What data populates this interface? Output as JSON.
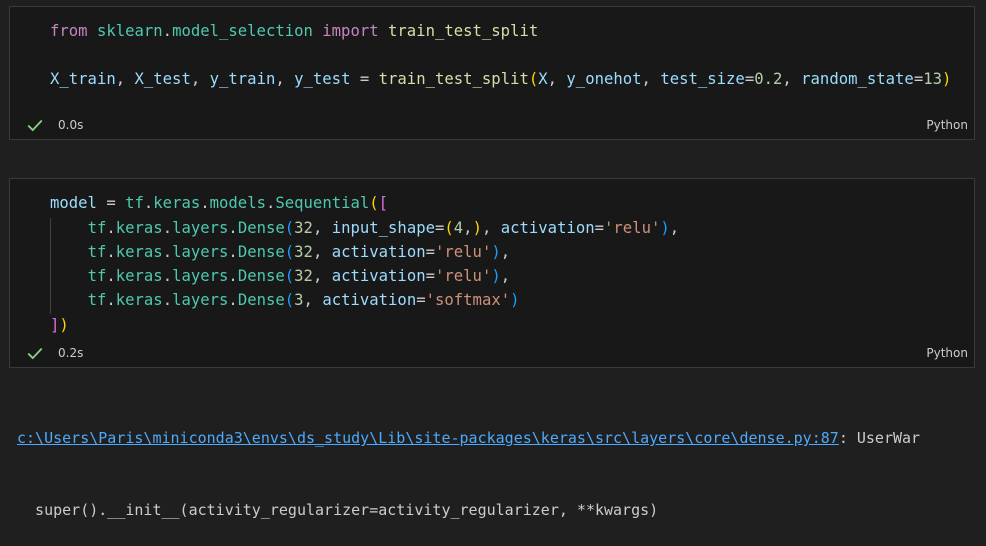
{
  "cells": [
    {
      "exec_time": "0.0s",
      "language": "Python",
      "lines": [
        [
          [
            "kw-ctrl",
            "from"
          ],
          [
            "plain",
            " "
          ],
          [
            "mod",
            "sklearn"
          ],
          [
            "plain",
            "."
          ],
          [
            "mod",
            "model_selection"
          ],
          [
            "plain",
            " "
          ],
          [
            "kw-ctrl",
            "import"
          ],
          [
            "plain",
            " "
          ],
          [
            "fn",
            "train_test_split"
          ]
        ],
        [],
        [
          [
            "var",
            "X_train"
          ],
          [
            "plain",
            ", "
          ],
          [
            "var",
            "X_test"
          ],
          [
            "plain",
            ", "
          ],
          [
            "var",
            "y_train"
          ],
          [
            "plain",
            ", "
          ],
          [
            "var",
            "y_test"
          ],
          [
            "plain",
            " = "
          ],
          [
            "fn",
            "train_test_split"
          ],
          [
            "b1",
            "("
          ],
          [
            "var",
            "X"
          ],
          [
            "plain",
            ", "
          ],
          [
            "var",
            "y_onehot"
          ],
          [
            "plain",
            ", "
          ],
          [
            "var",
            "test_size"
          ],
          [
            "plain",
            "="
          ],
          [
            "num",
            "0.2"
          ],
          [
            "plain",
            ", "
          ],
          [
            "var",
            "random_state"
          ],
          [
            "plain",
            "="
          ],
          [
            "num",
            "13"
          ],
          [
            "b1",
            ")"
          ]
        ]
      ]
    },
    {
      "exec_time": "0.2s",
      "language": "Python",
      "lines": [
        [
          [
            "var",
            "model"
          ],
          [
            "plain",
            " = "
          ],
          [
            "mod",
            "tf"
          ],
          [
            "plain",
            "."
          ],
          [
            "mod",
            "keras"
          ],
          [
            "plain",
            "."
          ],
          [
            "mod",
            "models"
          ],
          [
            "plain",
            "."
          ],
          [
            "mod",
            "Sequential"
          ],
          [
            "b1",
            "("
          ],
          [
            "b2",
            "["
          ]
        ],
        [
          [
            "plain",
            "    "
          ],
          [
            "mod",
            "tf"
          ],
          [
            "plain",
            "."
          ],
          [
            "mod",
            "keras"
          ],
          [
            "plain",
            "."
          ],
          [
            "mod",
            "layers"
          ],
          [
            "plain",
            "."
          ],
          [
            "mod",
            "Dense"
          ],
          [
            "b3",
            "("
          ],
          [
            "num",
            "32"
          ],
          [
            "plain",
            ", "
          ],
          [
            "var",
            "input_shape"
          ],
          [
            "plain",
            "="
          ],
          [
            "b1",
            "("
          ],
          [
            "num",
            "4"
          ],
          [
            "plain",
            ","
          ],
          [
            "b1",
            ")"
          ],
          [
            "plain",
            ", "
          ],
          [
            "var",
            "activation"
          ],
          [
            "plain",
            "="
          ],
          [
            "str",
            "'relu'"
          ],
          [
            "b3",
            ")"
          ],
          [
            "plain",
            ","
          ]
        ],
        [
          [
            "plain",
            "    "
          ],
          [
            "mod",
            "tf"
          ],
          [
            "plain",
            "."
          ],
          [
            "mod",
            "keras"
          ],
          [
            "plain",
            "."
          ],
          [
            "mod",
            "layers"
          ],
          [
            "plain",
            "."
          ],
          [
            "mod",
            "Dense"
          ],
          [
            "b3",
            "("
          ],
          [
            "num",
            "32"
          ],
          [
            "plain",
            ", "
          ],
          [
            "var",
            "activation"
          ],
          [
            "plain",
            "="
          ],
          [
            "str",
            "'relu'"
          ],
          [
            "b3",
            ")"
          ],
          [
            "plain",
            ","
          ]
        ],
        [
          [
            "plain",
            "    "
          ],
          [
            "mod",
            "tf"
          ],
          [
            "plain",
            "."
          ],
          [
            "mod",
            "keras"
          ],
          [
            "plain",
            "."
          ],
          [
            "mod",
            "layers"
          ],
          [
            "plain",
            "."
          ],
          [
            "mod",
            "Dense"
          ],
          [
            "b3",
            "("
          ],
          [
            "num",
            "32"
          ],
          [
            "plain",
            ", "
          ],
          [
            "var",
            "activation"
          ],
          [
            "plain",
            "="
          ],
          [
            "str",
            "'relu'"
          ],
          [
            "b3",
            ")"
          ],
          [
            "plain",
            ","
          ]
        ],
        [
          [
            "plain",
            "    "
          ],
          [
            "mod",
            "tf"
          ],
          [
            "plain",
            "."
          ],
          [
            "mod",
            "keras"
          ],
          [
            "plain",
            "."
          ],
          [
            "mod",
            "layers"
          ],
          [
            "plain",
            "."
          ],
          [
            "mod",
            "Dense"
          ],
          [
            "b3",
            "("
          ],
          [
            "num",
            "3"
          ],
          [
            "plain",
            ", "
          ],
          [
            "var",
            "activation"
          ],
          [
            "plain",
            "="
          ],
          [
            "str",
            "'softmax'"
          ],
          [
            "b3",
            ")"
          ]
        ],
        [
          [
            "b2",
            "]"
          ],
          [
            "b1",
            ")"
          ]
        ]
      ]
    }
  ],
  "output": {
    "warning_path": "c:\\Users\\Paris\\miniconda3\\envs\\ds_study\\Lib\\site-packages\\keras\\src\\layers\\core\\dense.py:87",
    "warning_suffix": ": UserWar",
    "line2": "  super().__init__(activity_regularizer=activity_regularizer, **kwargs)"
  },
  "colors": {
    "keyword": "#c586c0",
    "module": "#4ec9b0",
    "function": "#dcdcaa",
    "variable": "#9cdcfe",
    "number": "#b5cea8",
    "string": "#ce9178",
    "success_check": "#89d185",
    "link": "#4daafc"
  },
  "icons": {
    "status": "check-icon"
  }
}
